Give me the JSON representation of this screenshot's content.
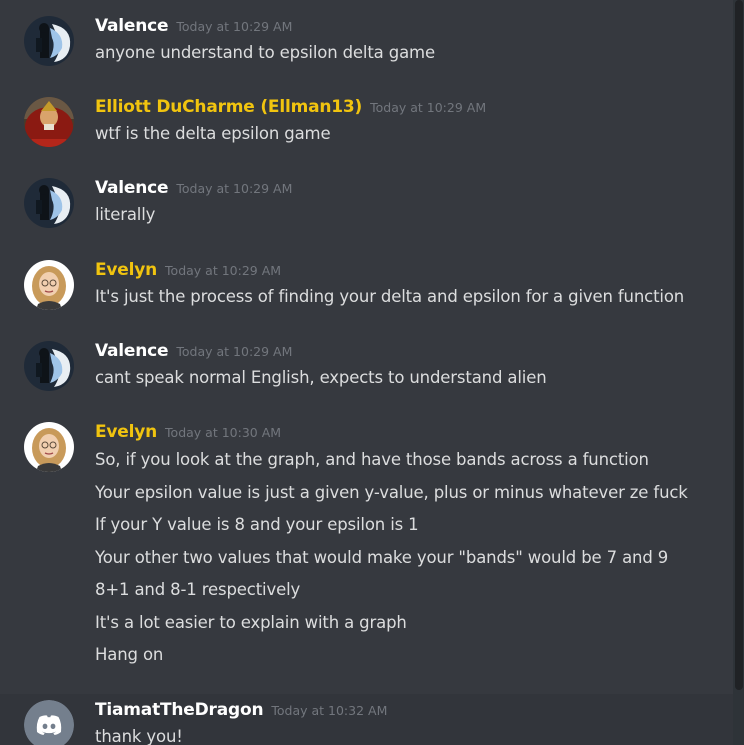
{
  "messages": [
    {
      "author": "Valence",
      "timestamp": "Today at 10:29 AM",
      "lines": [
        "anyone understand to epsilon delta game"
      ],
      "avatar_icon": "valence-avatar"
    },
    {
      "author": "Elliott DuCharme (Ellman13)",
      "timestamp": "Today at 10:29 AM",
      "lines": [
        "wtf is the delta epsilon game"
      ],
      "avatar_icon": "elliott-avatar"
    },
    {
      "author": "Valence",
      "timestamp": "Today at 10:29 AM",
      "lines": [
        "literally"
      ],
      "avatar_icon": "valence-avatar"
    },
    {
      "author": "Evelyn",
      "timestamp": "Today at 10:29 AM",
      "lines": [
        "It's just the process of finding your delta and epsilon for a given function"
      ],
      "avatar_icon": "evelyn-avatar"
    },
    {
      "author": "Valence",
      "timestamp": "Today at 10:29 AM",
      "lines": [
        "cant speak normal English, expects to understand alien"
      ],
      "avatar_icon": "valence-avatar"
    },
    {
      "author": "Evelyn",
      "timestamp": "Today at 10:30 AM",
      "lines": [
        "So, if you look at the graph, and have those bands across a function",
        "Your epsilon value is just a given y-value, plus or minus whatever ze fuck",
        "If your Y value is 8 and your epsilon is 1",
        "Your other two values that would make your \"bands\" would be 7 and 9",
        "8+1 and 8-1 respectively",
        "It's a lot easier to explain with a graph",
        "Hang on"
      ],
      "avatar_icon": "evelyn-avatar"
    },
    {
      "author": "TiamatTheDragon",
      "timestamp": "Today at 10:32 AM",
      "lines": [
        "thank you!"
      ],
      "avatar_icon": "discord-default-avatar"
    }
  ],
  "colors": {
    "background": "#36393f",
    "hover_background": "#32353b",
    "default_name": "#ffffff",
    "role_gold": "#f1c40f",
    "message_text": "#dcddde",
    "timestamp": "#72767d",
    "discord_blurple": "#747f8d"
  }
}
